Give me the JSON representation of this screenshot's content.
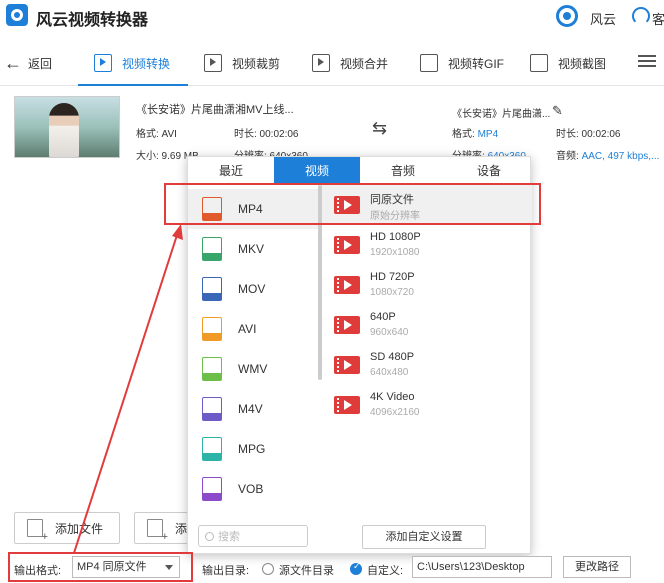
{
  "app": {
    "title": "风云视频转换器",
    "user": "风云",
    "help": "客"
  },
  "toolbar": {
    "items": [
      {
        "label": "返回"
      },
      {
        "label": "视频转换"
      },
      {
        "label": "视频裁剪"
      },
      {
        "label": "视频合并"
      },
      {
        "label": "视频转GIF"
      },
      {
        "label": "视频截图"
      }
    ]
  },
  "source_file": {
    "name": "《长安诺》片尾曲潇湘MV上线...",
    "format_label": "格式: AVI",
    "duration_label": "时长: 00:02:06",
    "size_label": "大小: 9.69 MB",
    "resolution_label": "分辨率: 640x360"
  },
  "output_file": {
    "name": "《长安诺》片尾曲潇...",
    "format_key": "格式:",
    "format_value": "MP4",
    "duration_label": "时长: 00:02:06",
    "resolution_key": "分辨率:",
    "resolution_value": "640x360",
    "audio_key": "音频:",
    "audio_value": "AAC, 497 kbps,..."
  },
  "format_popup": {
    "tabs": [
      "最近",
      "视频",
      "音频",
      "设备"
    ],
    "active_tab": "视频",
    "formats": [
      "MP4",
      "MKV",
      "MOV",
      "AVI",
      "WMV",
      "M4V",
      "MPG",
      "VOB"
    ],
    "selected_format": "MP4",
    "resolutions": [
      {
        "name": "同原文件",
        "sub": "原始分辨率"
      },
      {
        "name": "HD 1080P",
        "sub": "1920x1080"
      },
      {
        "name": "HD 720P",
        "sub": "1080x720"
      },
      {
        "name": "640P",
        "sub": "960x640"
      },
      {
        "name": "SD 480P",
        "sub": "640x480"
      },
      {
        "name": "4K Video",
        "sub": "4096x2160"
      }
    ],
    "search_placeholder": "搜索",
    "add_custom_label": "添加自定义设置"
  },
  "actions": {
    "add_file": "添加文件",
    "add_folder": "添"
  },
  "bottom": {
    "output_format_label": "输出格式:",
    "output_format_value": "MP4 同原文件",
    "output_dir_label": "输出目录:",
    "source_dir_label": "源文件目录",
    "custom_label": "自定义:",
    "path": "C:\\Users\\123\\Desktop",
    "change_path": "更改路径"
  },
  "colors": {
    "accent": "#1e7fd8",
    "annotation": "#e23b3b",
    "video_icon": "#e03b3b"
  }
}
